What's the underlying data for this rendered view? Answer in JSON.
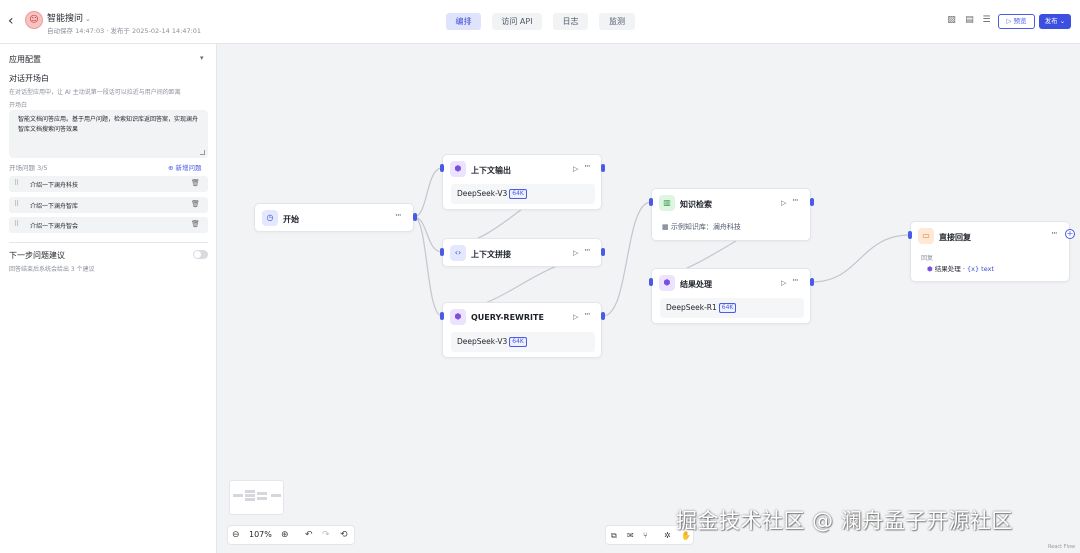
{
  "header": {
    "app_icon": "robot-icon",
    "app_name": "智能搜问",
    "meta": "自动保存 14:47:03 · 发布于 2025-02-14 14:47:01",
    "tabs": [
      {
        "label": "编排",
        "active": true
      },
      {
        "label": "访问 API",
        "active": false
      },
      {
        "label": "日志",
        "active": false
      },
      {
        "label": "监测",
        "active": false
      }
    ],
    "preview_label": "▷ 预览",
    "publish_label": "发布 ⌄",
    "accent_color": "#3d4fe0"
  },
  "panel": {
    "section_title": "应用配置",
    "opening_title": "对话开场白",
    "opening_desc": "在对话型应用中，让 AI 主动说第一段话可以拉近与用户间的距离",
    "opening_label": "开场白",
    "opening_text": "智能文档问答应用。基于用户问题，检索知识库返回答案，实现澜舟智库文档搜索问答效果",
    "questions_label": "开场问题 3/5",
    "add_question_label": "新增问题",
    "questions": [
      "介绍一下澜舟科技",
      "介绍一下澜舟智库",
      "介绍一下澜舟智会"
    ],
    "next_title": "下一步问题建议",
    "next_desc": "回答结束后系统会给出 3 个建议",
    "next_enabled": false
  },
  "nodes": {
    "start": {
      "title": "开始",
      "icon": "timer-icon"
    },
    "context_output": {
      "title": "上下文输出",
      "model": "DeepSeek-V3",
      "badge": "64K",
      "icon": "cube-icon"
    },
    "context_concat": {
      "title": "上下文拼接",
      "icon": "code-icon"
    },
    "query_rewrite": {
      "title": "QUERY-REWRITE",
      "model": "DeepSeek-V3",
      "badge": "64K",
      "icon": "cube-icon"
    },
    "knowledge": {
      "title": "知识检索",
      "body": "示例知识库：澜舟科技",
      "icon": "book-icon"
    },
    "result": {
      "title": "结果处理",
      "model": "DeepSeek-R1",
      "badge": "64K",
      "icon": "cube-icon"
    },
    "reply": {
      "title": "直接回复",
      "label": "回复",
      "ref_node": "结果处理",
      "ref_sep": "·",
      "ref_var": "{x} text",
      "icon": "message-icon"
    }
  },
  "canvas": {
    "zoom": "107%",
    "attribution": "React Flow"
  },
  "watermark": "掘金技术社区 @ 澜舟孟子开源社区"
}
